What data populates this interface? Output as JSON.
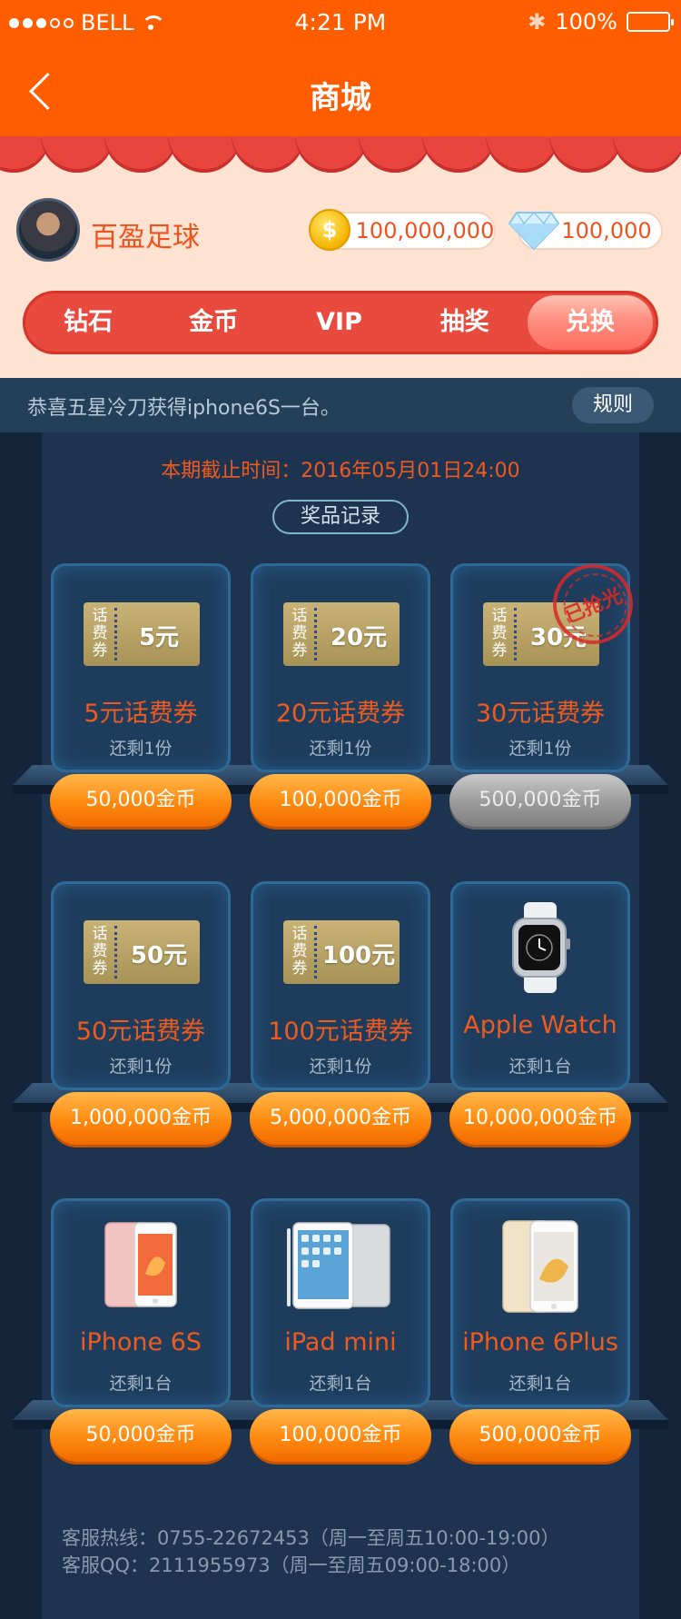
{
  "status_bar": {
    "carrier": "BELL",
    "time": "4:21 PM",
    "battery": "100%"
  },
  "header": {
    "title": "商城"
  },
  "profile": {
    "username": "百盈足球",
    "coins": "100,000,000",
    "gems": "100,000"
  },
  "tabs": [
    {
      "label": "钻石"
    },
    {
      "label": "金币"
    },
    {
      "label": "VIP"
    },
    {
      "label": "抽奖"
    },
    {
      "label": "兑换",
      "active": true
    }
  ],
  "notice": {
    "text": "恭喜五星冷刀获得iphone6S一台。",
    "rules_label": "规则"
  },
  "deadline": "本期截止时间：2016年05月01日24:00",
  "record_label": "奖品记录",
  "products": [
    {
      "type": "ticket",
      "ticket_side": "话费券",
      "ticket_amount": "5元",
      "name": "5元话费券",
      "stock": "还剩1份",
      "price": "50,000金币"
    },
    {
      "type": "ticket",
      "ticket_side": "话费券",
      "ticket_amount": "20元",
      "name": "20元话费券",
      "stock": "还剩1份",
      "price": "100,000金币"
    },
    {
      "type": "ticket",
      "ticket_side": "话费券",
      "ticket_amount": "30元",
      "name": "30元话费券",
      "stock": "还剩1份",
      "price": "500,000金币",
      "sold_out": true,
      "stamp": "已抢光"
    },
    {
      "type": "ticket",
      "ticket_side": "话费券",
      "ticket_amount": "50元",
      "name": "50元话费券",
      "stock": "还剩1份",
      "price": "1,000,000金币"
    },
    {
      "type": "ticket",
      "ticket_side": "话费券",
      "ticket_amount": "100元",
      "name": "100元话费券",
      "stock": "还剩1份",
      "price": "5,000,000金币"
    },
    {
      "type": "watch",
      "name": "Apple Watch",
      "stock": "还剩1台",
      "price": "10,000,000金币"
    },
    {
      "type": "phone-pink",
      "name": "iPhone 6S",
      "stock": "还剩1台",
      "price": "50,000金币"
    },
    {
      "type": "tablet",
      "name": "iPad mini",
      "stock": "还剩1台",
      "price": "100,000金币"
    },
    {
      "type": "phone-gold",
      "name": "iPhone 6Plus",
      "stock": "还剩1台",
      "price": "500,000金币"
    }
  ],
  "footer": {
    "hotline": "客服热线：0755-22672453（周一至周五10:00-19:00）",
    "qq": "客服QQ：2111955973（周一至周五09:00-18:00）"
  },
  "colors": {
    "primary": "#ff5d00",
    "tab_red": "#e84a3e",
    "price_orange": "#ff8a10",
    "name_orange": "#ef5a1f",
    "panel": "#1d3350"
  }
}
